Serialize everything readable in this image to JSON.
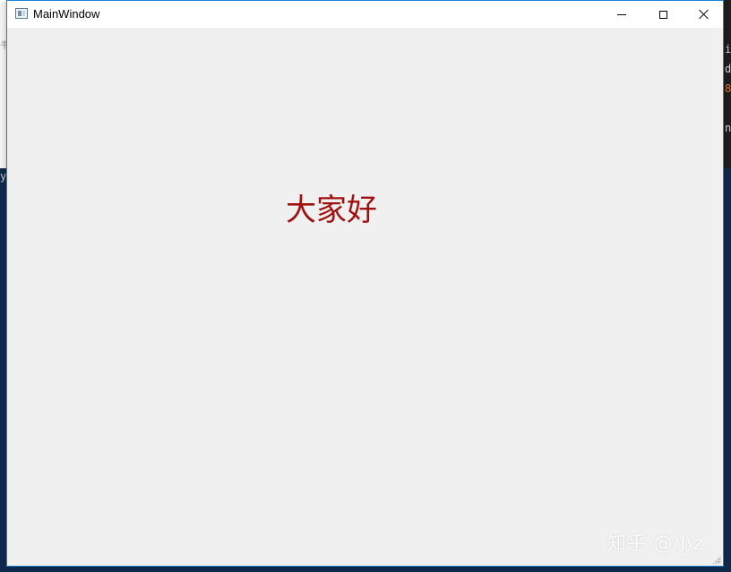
{
  "window": {
    "title": "MainWindow",
    "buttons": {
      "minimize_icon": "minimize-icon",
      "maximize_icon": "maximize-icon",
      "close_icon": "close-icon"
    }
  },
  "content": {
    "greeting": "大家好",
    "greeting_color": "#a01010"
  },
  "watermark": {
    "text": "知乎 @小z"
  },
  "background": {
    "left_y": "y",
    "right_lines": [
      "i",
      "d",
      "8",
      "",
      "n"
    ],
    "left_lines": [
      "书",
      "",
      ""
    ]
  },
  "colors": {
    "accent_border": "#1883d7",
    "client_bg": "#f0f0f0",
    "desktop_dark": "#0f2a4d"
  }
}
